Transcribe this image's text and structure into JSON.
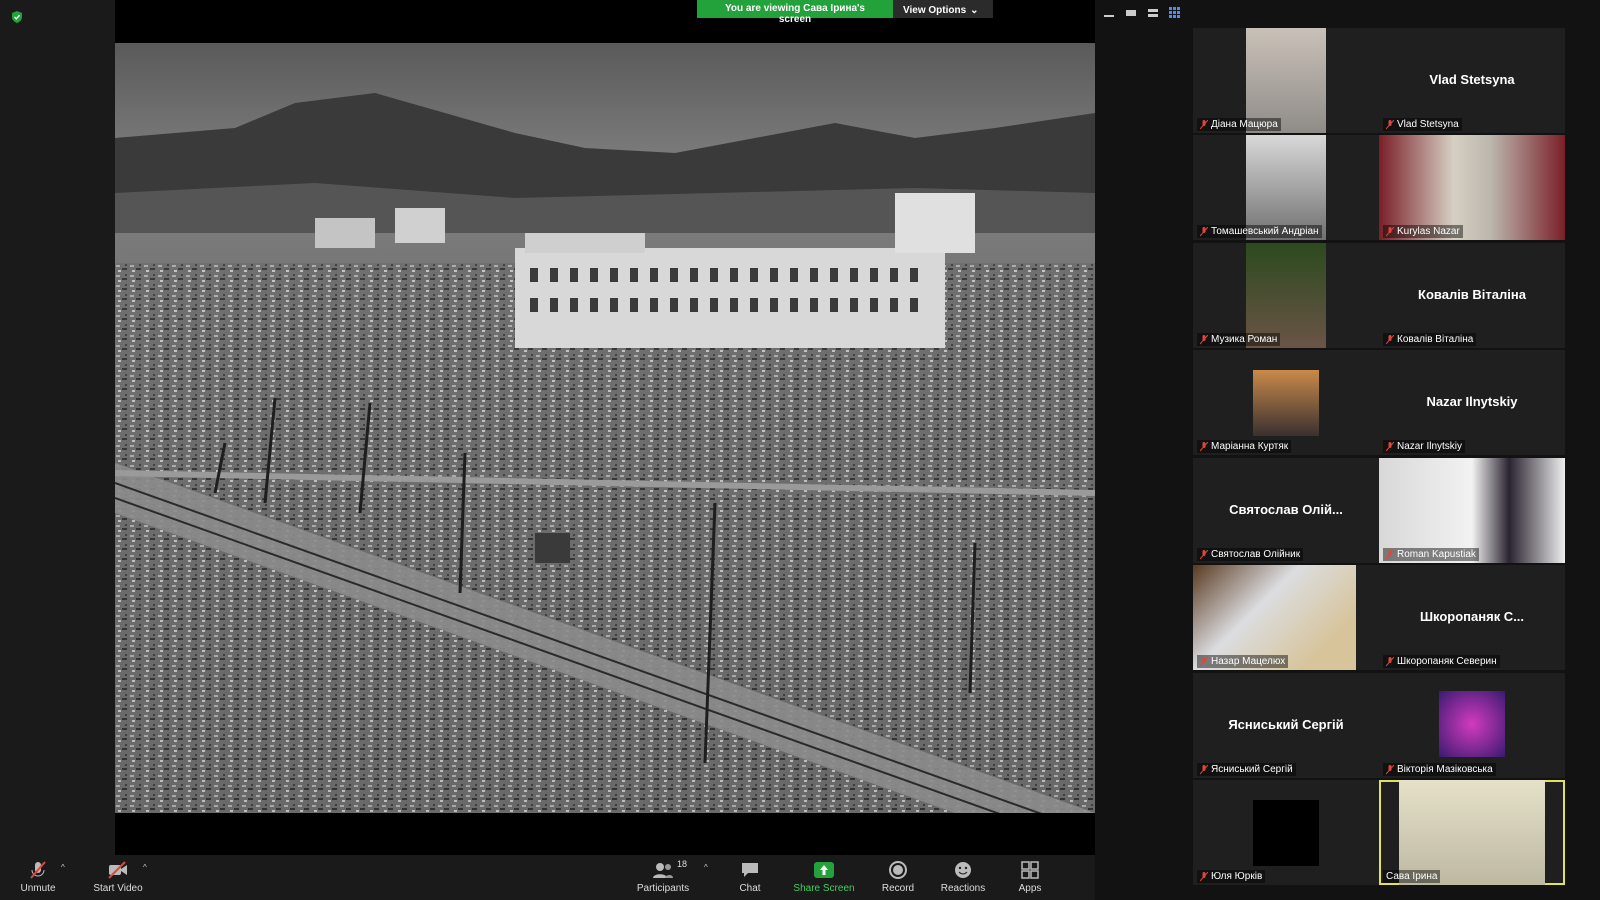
{
  "share": {
    "banner_text": "You are viewing Сава Ірина's screen",
    "view_options": "View Options",
    "view_options_caret": "⌄"
  },
  "gallery": {
    "tiles": [
      {
        "label": "Діана Мацюра",
        "has_video": true,
        "bigname": ""
      },
      {
        "label": "Vlad Stetsyna",
        "has_video": false,
        "bigname": "Vlad Stetsyna"
      },
      {
        "label": "Томашевський Андріан",
        "has_video": true,
        "bigname": ""
      },
      {
        "label": "Kurylas Nazar",
        "has_video": true,
        "bigname": ""
      },
      {
        "label": "Музика Роман",
        "has_video": true,
        "bigname": ""
      },
      {
        "label": "Ковалів Віталіна",
        "has_video": false,
        "bigname": "Ковалів Віталіна"
      },
      {
        "label": "Маріанна Куртяк",
        "has_video": true,
        "bigname": ""
      },
      {
        "label": "Nazar Ilnytskiy",
        "has_video": false,
        "bigname": "Nazar Ilnytskiy"
      },
      {
        "label": "Святослав Олійник",
        "has_video": false,
        "bigname": "Святослав Олій..."
      },
      {
        "label": "Roman Kapustiak",
        "has_video": true,
        "bigname": ""
      },
      {
        "label": "Назар Мацелюх",
        "has_video": true,
        "bigname": ""
      },
      {
        "label": "Шкоропаняк Северин",
        "has_video": false,
        "bigname": "Шкоропаняк С..."
      },
      {
        "label": "Ясниський Сергій",
        "has_video": false,
        "bigname": "Ясниський Сергій"
      },
      {
        "label": "Вікторія Мазіковська",
        "has_video": true,
        "bigname": ""
      },
      {
        "label": "Юля Юрків",
        "has_video": true,
        "bigname": ""
      },
      {
        "label": "Сава Ірина",
        "has_video": true,
        "bigname": "",
        "active": true
      }
    ]
  },
  "toolbar": {
    "unmute": "Unmute",
    "start_video": "Start Video",
    "participants": "Participants",
    "participants_count": "18",
    "chat": "Chat",
    "share_screen": "Share Screen",
    "record": "Record",
    "reactions": "Reactions",
    "apps": "Apps",
    "caret": "^"
  },
  "colors": {
    "banner_green": "#23a23c",
    "share_green": "#3ccf5e",
    "mic_muted_red": "#e0463a",
    "active_speaker": "#e2e25a"
  }
}
